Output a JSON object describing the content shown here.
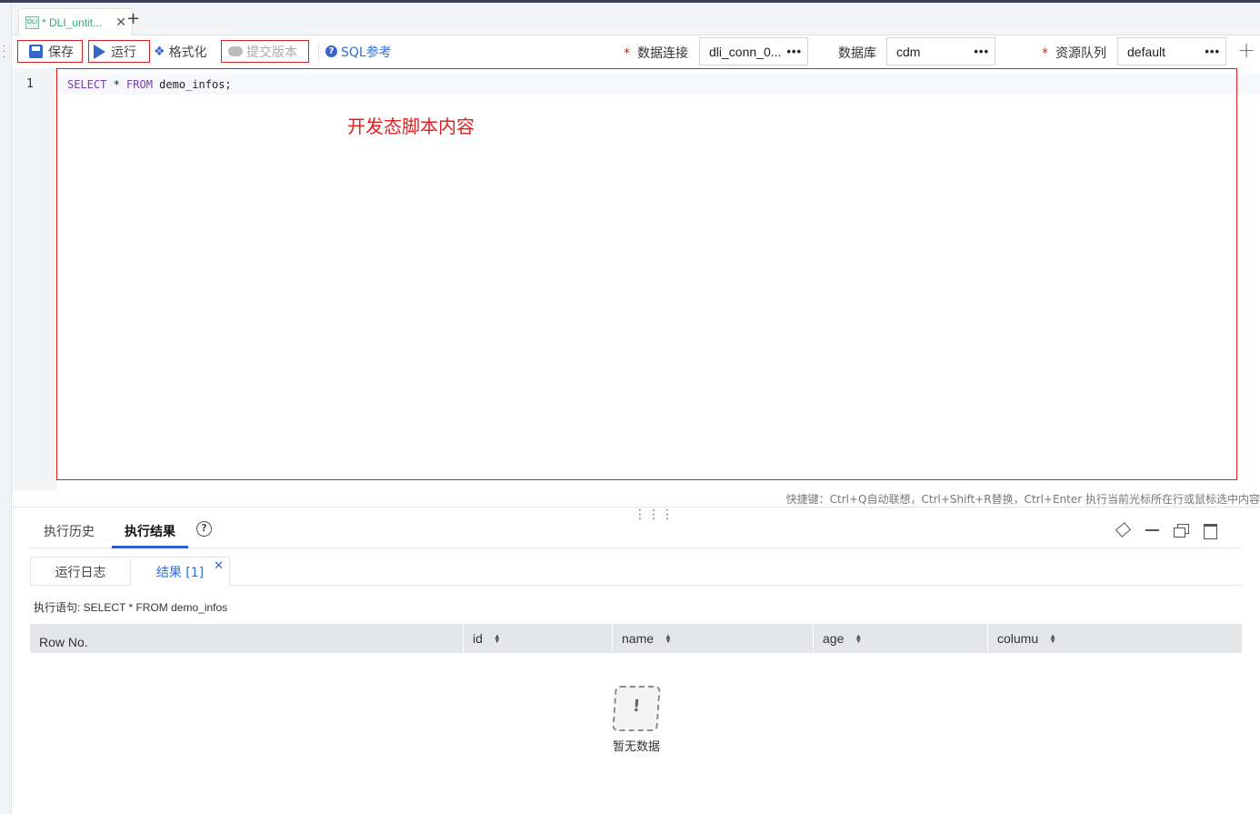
{
  "tab": {
    "icon_text": "DLI",
    "title": "* DLI_untit...",
    "close": "✕",
    "add": "+"
  },
  "toolbar": {
    "save_label": "保存",
    "run_label": "运行",
    "format_label": "格式化",
    "submit_label": "提交版本",
    "sqlref_label": "SQL参考",
    "connection": {
      "required": "*",
      "label": "数据连接",
      "value": "dli_conn_0..."
    },
    "database": {
      "label": "数据库",
      "value": "cdm"
    },
    "queue": {
      "required": "*",
      "label": "资源队列",
      "value": "default"
    },
    "more": "•••",
    "add": "+"
  },
  "editor": {
    "line_number": "1",
    "kw_select": "SELECT",
    "star": " * ",
    "kw_from": "FROM",
    "rest": " demo_infos;",
    "annotation": "开发态脚本内容",
    "shortcuts": "快捷键：Ctrl+Q自动联想，Ctrl+Shift+R替换，Ctrl+Enter 执行当前光标所在行或鼠标选中内容"
  },
  "panel": {
    "tab_history": "执行历史",
    "tab_results": "执行结果",
    "help": "?",
    "subtab_log": "运行日志",
    "subtab_result": "结果 [1]",
    "subtab_close": "✕",
    "statement": "执行语句: SELECT * FROM demo_infos",
    "columns": [
      "Row No.",
      "id",
      "name",
      "age",
      "columu"
    ],
    "empty_text": "暂无数据",
    "empty_icon": "!"
  },
  "colors": {
    "accent": "#2f6fd6",
    "highlight_box": "#d81e1e",
    "tab_green": "#2eaa7f"
  }
}
